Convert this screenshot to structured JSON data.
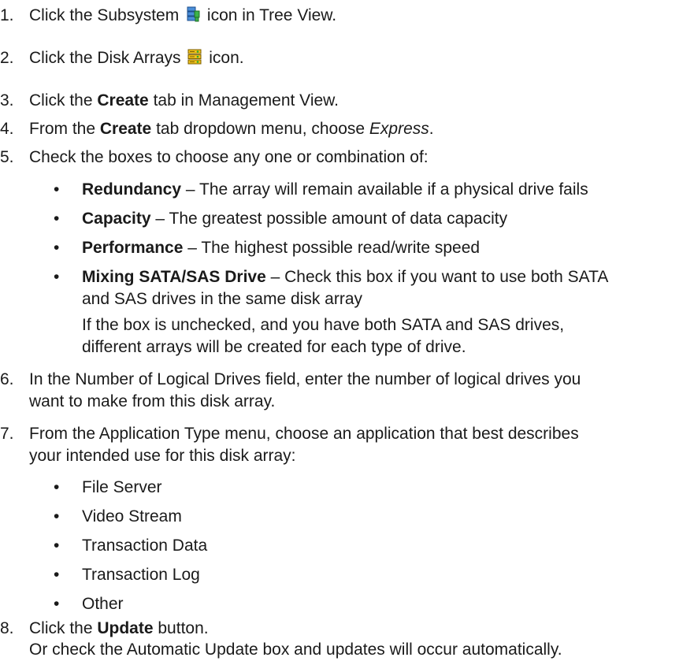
{
  "steps": [
    {
      "num": "1.",
      "pre": "Click the Subsystem",
      "icon": "subsystem-icon",
      "post": "icon in Tree View."
    },
    {
      "num": "2.",
      "pre": "Click the Disk Arrays",
      "icon": "disk-arrays-icon",
      "post": "icon."
    },
    {
      "num": "3.",
      "pre": "Click the ",
      "bold": "Create",
      "post": " tab in Management View."
    },
    {
      "num": "4.",
      "pre": "From the ",
      "bold": "Create",
      "mid": " tab dropdown menu, choose ",
      "italic": "Express",
      "post": "."
    },
    {
      "num": "5.",
      "text": "Check the boxes to choose any one or combination of:"
    },
    {
      "num": "6.",
      "line1": "In the Number of Logical Drives field, enter the number of logical drives you",
      "line2": "want to make from this disk array."
    },
    {
      "num": "7.",
      "line1": "From the Application Type menu, choose an application that best describes",
      "line2": "your intended use for this disk array:"
    },
    {
      "num": "8.",
      "pre": "Click the ",
      "bold": "Update",
      "post": " button.",
      "note": "Or check the Automatic Update box and updates will occur automatically."
    }
  ],
  "options": [
    {
      "term": "Redundancy",
      "desc": " – The array will remain available if a physical drive fails"
    },
    {
      "term": "Capacity",
      "desc": " – The greatest possible amount of data capacity"
    },
    {
      "term": "Performance",
      "desc": " – The highest possible read/write speed"
    },
    {
      "term": "Mixing SATA/SAS Drive",
      "desc_line1": " – Check this box if you want to use both SATA",
      "desc_line2": "and SAS drives in the same disk array",
      "note_line1": "If the box is unchecked, and you have both SATA and SAS drives,",
      "note_line2": "different arrays will be created for each type of drive."
    }
  ],
  "application_types": [
    "File Server",
    "Video Stream",
    "Transaction Data",
    "Transaction Log",
    "Other"
  ],
  "bullet_glyph": "•"
}
